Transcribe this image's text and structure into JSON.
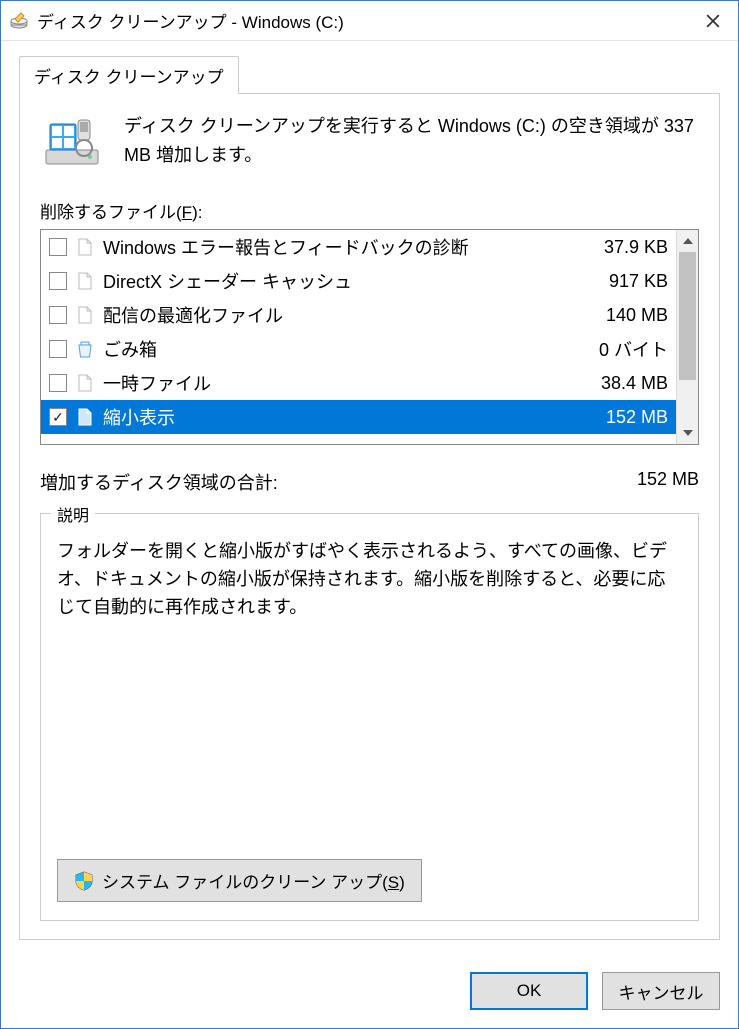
{
  "window": {
    "title": "ディスク クリーンアップ - Windows (C:)"
  },
  "tab": {
    "label": "ディスク クリーンアップ"
  },
  "summary": {
    "text": "ディスク クリーンアップを実行すると Windows (C:) の空き領域が 337 MB 増加します。"
  },
  "files": {
    "label_prefix": "削除するファイル(",
    "label_key": "F",
    "label_suffix": "):",
    "items": [
      {
        "name": "Windows エラー報告とフィードバックの診断",
        "size": "37.9 KB",
        "checked": false,
        "icon": "file"
      },
      {
        "name": "DirectX シェーダー キャッシュ",
        "size": "917 KB",
        "checked": false,
        "icon": "file"
      },
      {
        "name": "配信の最適化ファイル",
        "size": "140 MB",
        "checked": false,
        "icon": "file"
      },
      {
        "name": "ごみ箱",
        "size": "0 バイト",
        "checked": false,
        "icon": "trash"
      },
      {
        "name": "一時ファイル",
        "size": "38.4 MB",
        "checked": false,
        "icon": "file"
      },
      {
        "name": "縮小表示",
        "size": "152 MB",
        "checked": true,
        "icon": "file",
        "selected": true
      }
    ]
  },
  "total": {
    "label": "増加するディスク領域の合計:",
    "value": "152 MB"
  },
  "description": {
    "legend": "説明",
    "text": "フォルダーを開くと縮小版がすばやく表示されるよう、すべての画像、ビデオ、ドキュメントの縮小版が保持されます。縮小版を削除すると、必要に応じて自動的に再作成されます。"
  },
  "sysclean": {
    "prefix": "システム ファイルのクリーン アップ(",
    "key": "S",
    "suffix": ")"
  },
  "buttons": {
    "ok": "OK",
    "cancel": "キャンセル"
  }
}
